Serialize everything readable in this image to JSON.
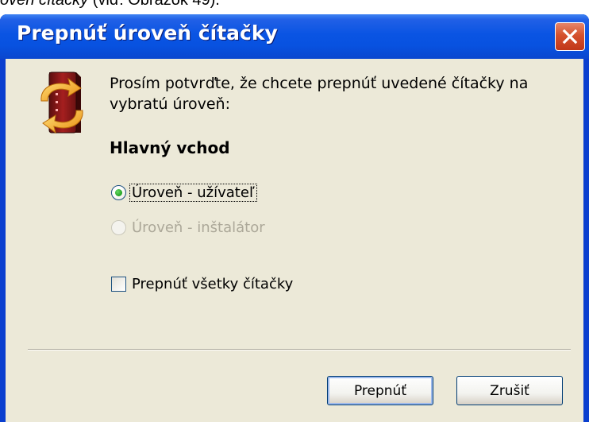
{
  "document": {
    "caption_prefix": "oveň čítačky",
    "caption_suffix": " (viď: Obrázok 49)."
  },
  "dialog": {
    "title": "Prepnúť úroveň čítačky",
    "prompt": "Prosím potvrďte, že chcete prepnúť uvedené čítačky na vybratú úroveň:",
    "section_heading": "Hlavný vchod",
    "options": [
      {
        "label": "Úroveň - užívateľ",
        "checked": true,
        "enabled": true
      },
      {
        "label": "Úroveň - inštalátor",
        "checked": false,
        "enabled": false
      }
    ],
    "switch_all_label": "Prepnúť všetky čítačky",
    "switch_all_checked": false,
    "buttons": {
      "ok": "Prepnúť",
      "cancel": "Zrušiť"
    }
  },
  "colors": {
    "titlebar": "#0a54e3",
    "client_background": "#ece9d8",
    "close_button": "#d4512d",
    "disabled_text": "#aca899"
  },
  "icons": {
    "close": "close-icon",
    "app": "card-reader-switch-icon"
  }
}
